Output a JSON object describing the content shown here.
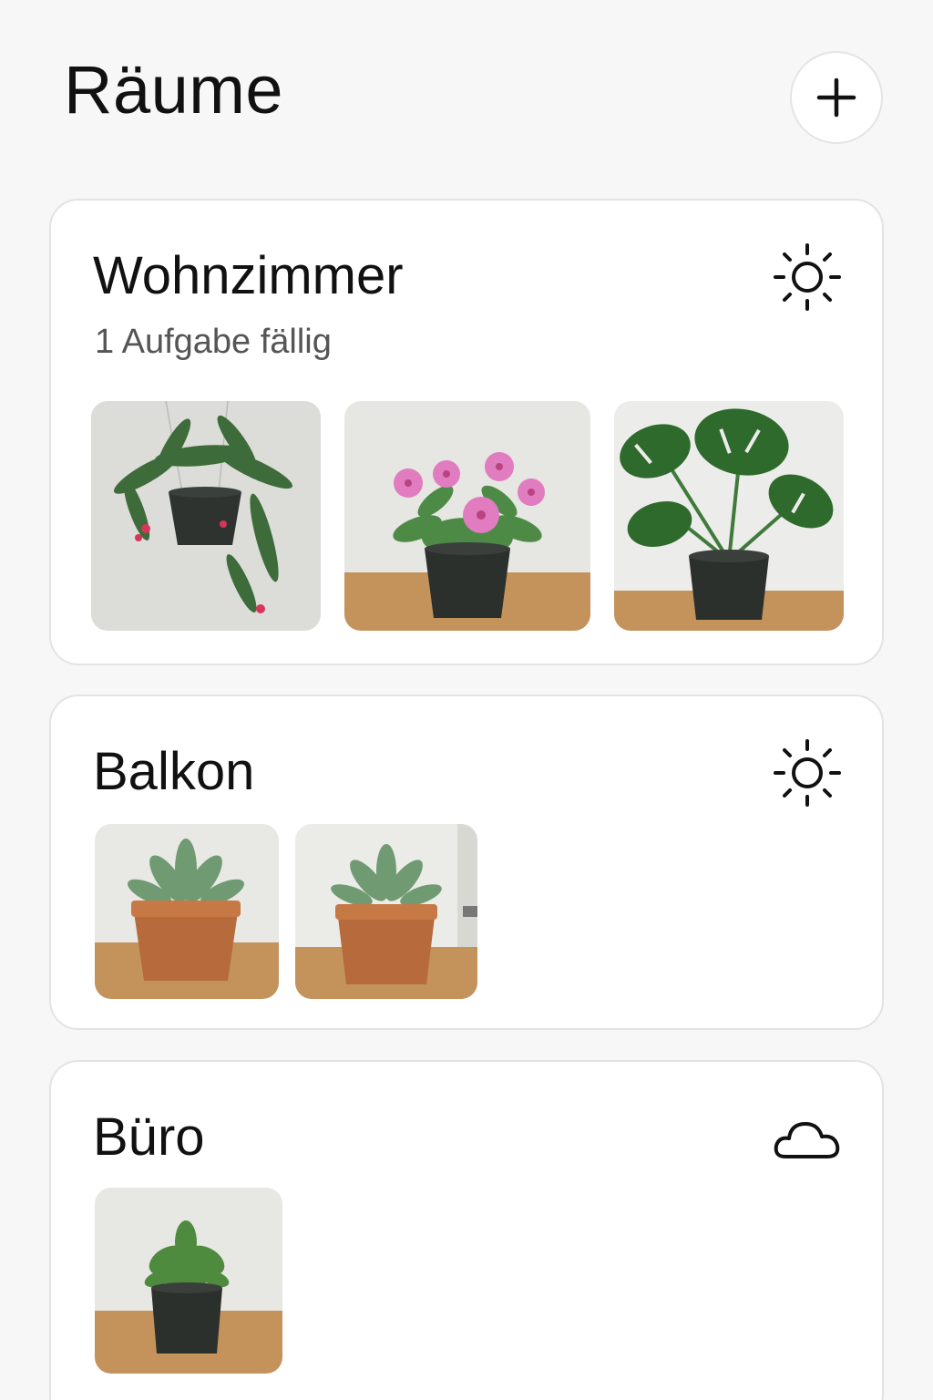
{
  "header": {
    "title": "Räume",
    "add_icon": "plus-icon"
  },
  "rooms": [
    {
      "name": "Wohnzimmer",
      "subtitle": "1 Aufgabe fällig",
      "weather_icon": "sun-icon",
      "plants": [
        "hanging-plant",
        "pink-flowering-plant",
        "monstera"
      ]
    },
    {
      "name": "Balkon",
      "subtitle": "",
      "weather_icon": "sun-icon",
      "plants": [
        "succulent",
        "succulent"
      ]
    },
    {
      "name": "Büro",
      "subtitle": "",
      "weather_icon": "cloud-icon",
      "plants": [
        "small-green-plant"
      ]
    }
  ],
  "colors": {
    "background": "#f7f7f7",
    "card": "#ffffff",
    "text": "#111111",
    "muted": "#555555"
  }
}
